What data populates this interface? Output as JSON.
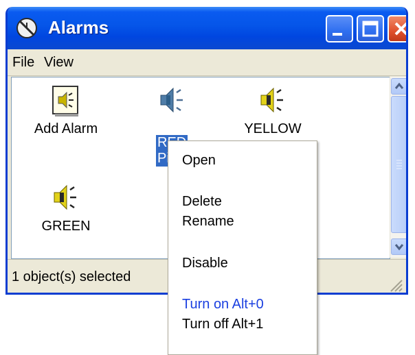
{
  "window": {
    "title": "Alarms",
    "icon": "alarm-clock-icon",
    "controls": {
      "minimize": "minimize-icon",
      "maximize": "maximize-icon",
      "close": "close-icon"
    }
  },
  "menu": {
    "items": [
      "File",
      "View"
    ]
  },
  "icons": [
    {
      "label": "Add Alarm",
      "icon": "add-alarm-icon"
    },
    {
      "label_line1": "RED",
      "label_line2": "Pi",
      "icon": "speaker-icon",
      "selected": true
    },
    {
      "label": "YELLOW",
      "icon": "speaker-icon"
    },
    {
      "label": "GREEN",
      "icon": "speaker-icon"
    }
  ],
  "status": {
    "text": "1 object(s) selected"
  },
  "context_menu": {
    "items": [
      "Open",
      "Delete",
      "Rename",
      "Disable",
      "Turn on Alt+0",
      "Turn off Alt+1"
    ],
    "highlight_color": "#1a3fe0"
  },
  "colors": {
    "titlebar": "#0555e8",
    "selection": "#316ac5",
    "window_bg": "#ece9d8"
  }
}
